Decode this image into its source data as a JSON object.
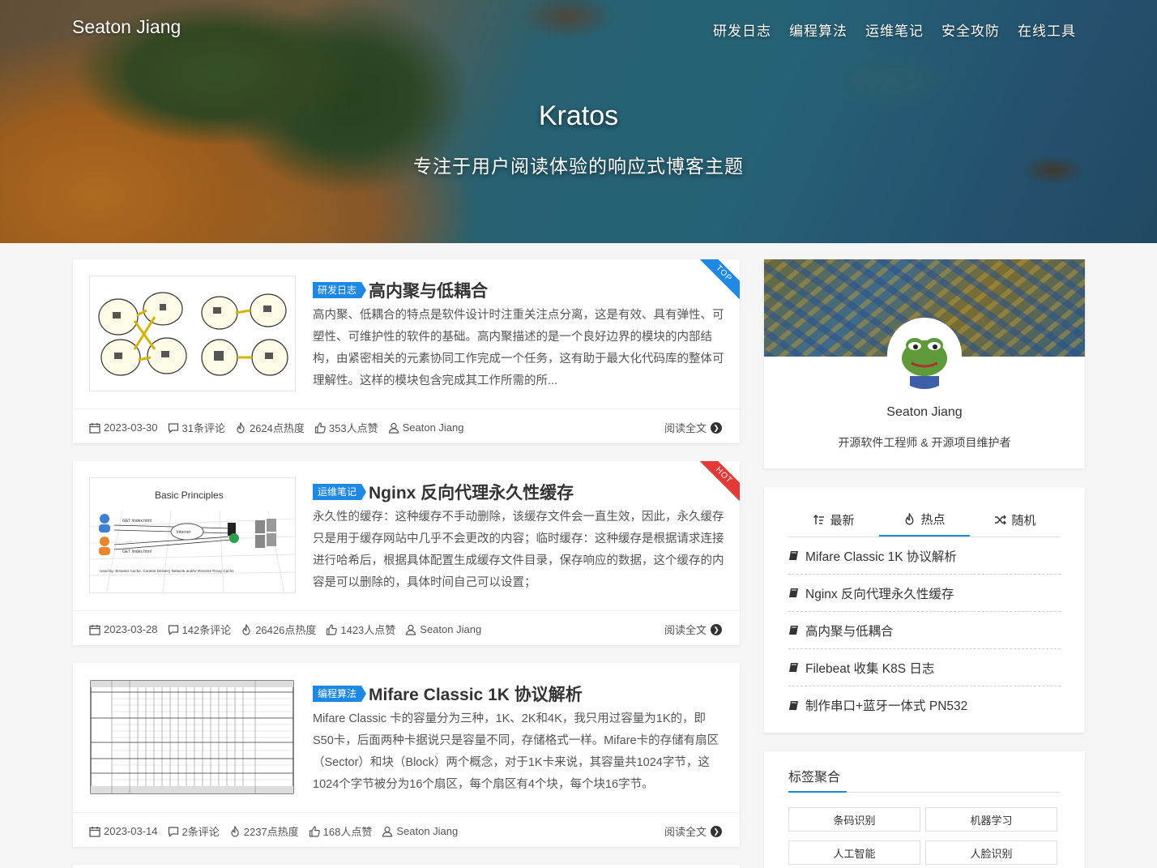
{
  "header": {
    "brand": "Seaton Jiang",
    "nav": [
      "研发日志",
      "编程算法",
      "运维笔记",
      "安全攻防",
      "在线工具"
    ],
    "hero_title": "Kratos",
    "hero_subtitle": "专注于用户阅读体验的响应式博客主题"
  },
  "posts": [
    {
      "category": "研发日志",
      "title": "高内聚与低耦合",
      "ribbon": "TOP",
      "ribbon_color": "#1e88e5",
      "excerpt": "高内聚、低耦合的特点是软件设计时注重关注点分离，这是有效、具有弹性、可塑性、可维护性的软件的基础。高内聚描述的是一个良好边界的模块的内部结构，由紧密相关的元素协同工作完成一个任务，这有助于最大化代码库的整体可理解性。这样的模块包含完成其工作所需的所...",
      "date": "2023-03-30",
      "comments": "31条评论",
      "views": "2624点热度",
      "likes": "353人点赞",
      "author": "Seaton Jiang",
      "read_more": "阅读全文"
    },
    {
      "category": "运维笔记",
      "title": "Nginx 反向代理永久性缓存",
      "ribbon": "HOT",
      "ribbon_color": "#e53935",
      "excerpt": "永久性的缓存：这种缓存不手动删除，该缓存文件会一直生效，因此，永久缓存只是用于缓存网站中几乎不会更改的内容；临时缓存：这种缓存是根据请求连接进行哈希后，根据具体配置生成缓存文件目录，保存响应的数据，这个缓存的内容是可以删除的，具体时间自己可以设置；",
      "date": "2023-03-28",
      "comments": "142条评论",
      "views": "26426点热度",
      "likes": "1423人点赞",
      "author": "Seaton Jiang",
      "read_more": "阅读全文",
      "thumb_caption": "Basic Principles",
      "thumb_labels": [
        "GET /index.html",
        "Internet",
        "GET /index.html",
        "Used by: Browser Cache, Content Delivery Network and/or Reverse Proxy Cache"
      ]
    },
    {
      "category": "编程算法",
      "title": "Mifare Classic 1K 协议解析",
      "excerpt": "Mifare Classic 卡的容量分为三种，1K、2K和4K，我只用过容量为1K的，即S50卡，后面两种卡据说只是容量不同，存储格式一样。Mifare卡的存储有扇区（Sector）和块（Block）两个概念，对于1K卡来说，其容量共1024字节，这1024个字节被分为16个扇区，每个扇区有4个块，每个块16字节。",
      "date": "2023-03-14",
      "comments": "2条评论",
      "views": "2237点热度",
      "likes": "168人点赞",
      "author": "Seaton Jiang",
      "read_more": "阅读全文"
    }
  ],
  "sidebar": {
    "profile": {
      "name": "Seaton Jiang",
      "desc": "开源软件工程师 & 开源项目维护者"
    },
    "tabs": [
      {
        "label": "最新",
        "icon": "sort-icon"
      },
      {
        "label": "热点",
        "icon": "fire-icon"
      },
      {
        "label": "随机",
        "icon": "shuffle-icon"
      }
    ],
    "active_tab": "热点",
    "hot_posts": [
      "Mifare Classic 1K 协议解析",
      "Nginx 反向代理永久性缓存",
      "高内聚与低耦合",
      "Filebeat 收集 K8S 日志",
      "制作串口+蓝牙一体式 PN532"
    ],
    "tags_title": "标签聚合",
    "tags": [
      "条码识别",
      "机器学习",
      "人工智能",
      "人脸识别"
    ]
  },
  "colors": {
    "accent": "#1e88e5",
    "hot": "#e53935"
  }
}
